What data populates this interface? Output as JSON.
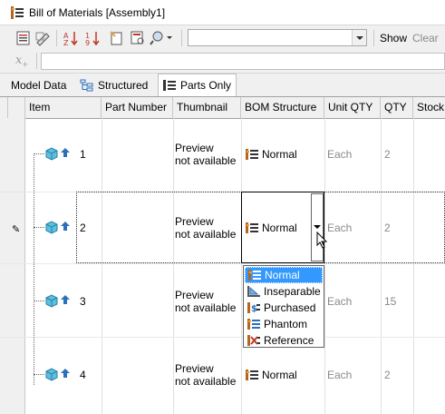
{
  "window": {
    "title": "Bill of Materials [Assembly1]"
  },
  "toolbar": {
    "icons": [
      "bom-view-icon",
      "export-icon",
      "sort-ascending-icon",
      "sort-descending-icon",
      "new-icon",
      "zoom-icon",
      "find-icon"
    ],
    "filter_value": "",
    "show_label": "Show",
    "clear_label": "Clear"
  },
  "formula": {
    "icon_label": "x",
    "value": ""
  },
  "tabs": [
    {
      "label": "Model Data",
      "active": false
    },
    {
      "label": "Structured",
      "active": false
    },
    {
      "label": "Parts Only",
      "active": true
    }
  ],
  "columns": [
    "Item",
    "Part Number",
    "Thumbnail",
    "BOM Structure",
    "Unit QTY",
    "QTY",
    "Stock"
  ],
  "rows": [
    {
      "item": "1",
      "part_number": "",
      "thumbnail_line1": "Preview",
      "thumbnail_line2": "not available",
      "bom_structure": "Normal",
      "unit_qty": "Each",
      "qty": "2"
    },
    {
      "item": "2",
      "part_number": "",
      "thumbnail_line1": "Preview",
      "thumbnail_line2": "not available",
      "bom_structure": "Normal",
      "unit_qty": "Each",
      "qty": "2"
    },
    {
      "item": "3",
      "part_number": "",
      "thumbnail_line1": "Preview",
      "thumbnail_line2": "not available",
      "bom_structure": "",
      "unit_qty": "Each",
      "qty": "15"
    },
    {
      "item": "4",
      "part_number": "",
      "thumbnail_line1": "Preview",
      "thumbnail_line2": "not available",
      "bom_structure": "Normal",
      "unit_qty": "Each",
      "qty": "2"
    }
  ],
  "bom_dropdown": {
    "selected": "Normal",
    "options": [
      "Normal",
      "Inseparable",
      "Purchased",
      "Phantom",
      "Reference"
    ]
  },
  "colors": {
    "selection": "#3399ff",
    "gray_text": "#8a8a8a",
    "part_cube": "#5bc0de"
  }
}
